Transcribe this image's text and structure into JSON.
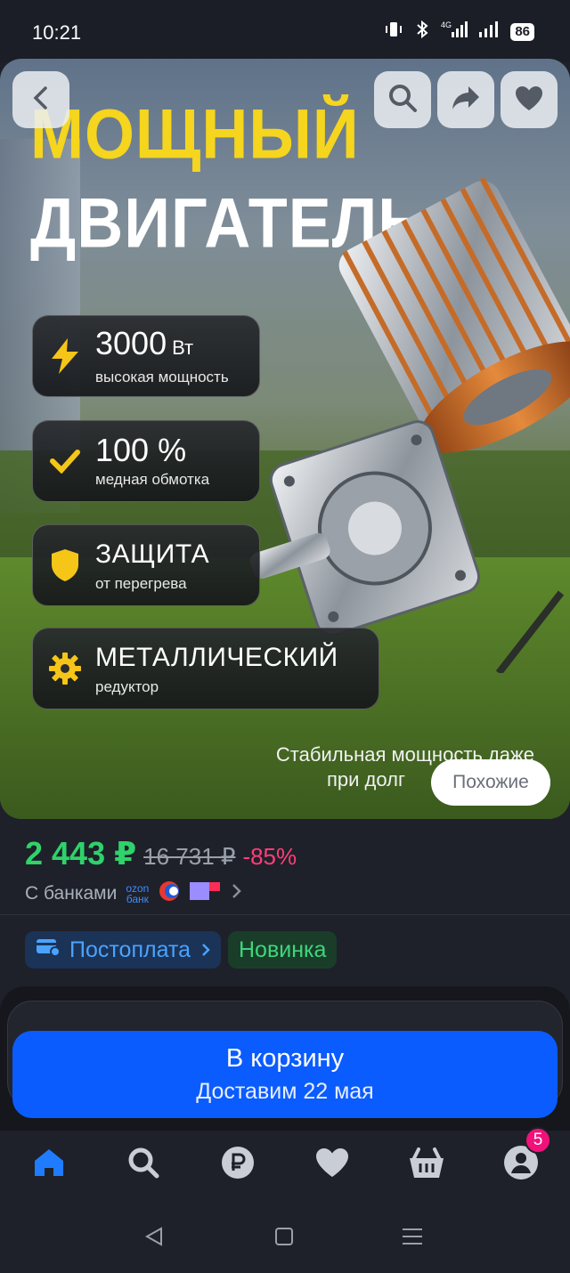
{
  "status": {
    "time": "10:21",
    "battery": "86",
    "network": "4G"
  },
  "hero": {
    "title_line1": "МОЩНЫЙ",
    "title_line2": "ДВИГАТЕЛЬ",
    "features": [
      {
        "main": "3000",
        "unit": "Вт",
        "sub": "высокая мощность",
        "icon": "lightning-icon"
      },
      {
        "main": "100 %",
        "unit": "",
        "sub": "медная обмотка",
        "icon": "checkmark-icon"
      },
      {
        "main": "ЗАЩИТА",
        "unit": "",
        "sub": "от перегрева",
        "icon": "shield-icon"
      },
      {
        "main": "МЕТАЛЛИЧЕСКИЙ",
        "unit": "",
        "sub": "редуктор",
        "icon": "gear-icon"
      }
    ],
    "caption_line1": "Стабильная мощность даже",
    "caption_line2": "при долг",
    "similar_label": "Похожие"
  },
  "price": {
    "current": "2 443 ₽",
    "old": "16 731 ₽",
    "discount": "-85%",
    "banks_label": "С банками",
    "ozon_bank_line1": "ozon",
    "ozon_bank_line2": "банк"
  },
  "tags": {
    "postpay": "Постоплата",
    "new": "Новинка"
  },
  "cart": {
    "title": "В корзину",
    "subtitle": "Доставим 22 мая"
  },
  "tabbar": {
    "profile_badge": "5"
  },
  "colors": {
    "accent": "#0b5cff",
    "price": "#2fd26b",
    "discount": "#ff3d7a",
    "title_yellow": "#f5d51e"
  }
}
